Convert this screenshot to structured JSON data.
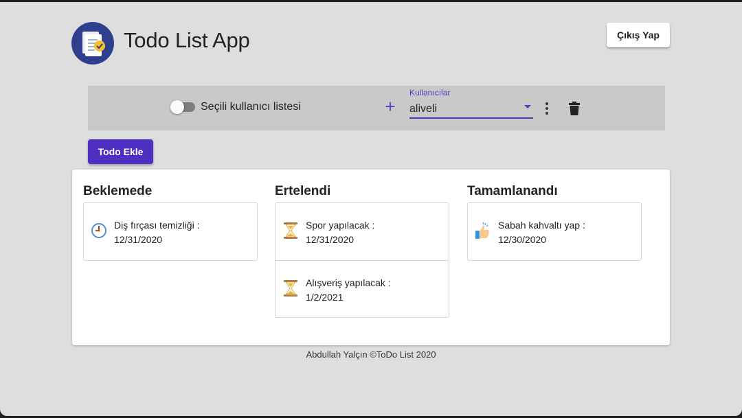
{
  "header": {
    "title": "Todo List App",
    "logout_label": "Çıkış Yap"
  },
  "toolbar": {
    "switch_label": "Seçili kullanıcı listesi",
    "add_user_glyph": "+",
    "select_label": "Kullanıcılar",
    "select_value": "aliveli"
  },
  "actions": {
    "add_todo_label": "Todo Ekle"
  },
  "columns": [
    {
      "title": "Beklemede",
      "icon": "clock-icon",
      "items": [
        {
          "title": "Diş fırçası temizliği :",
          "date": "12/31/2020"
        }
      ]
    },
    {
      "title": "Ertelendi",
      "icon": "hourglass-icon",
      "items": [
        {
          "title": "Spor yapılacak :",
          "date": "12/31/2020"
        },
        {
          "title": "Alışveriş yapılacak :",
          "date": "1/2/2021"
        }
      ]
    },
    {
      "title": "Tamamlanandı",
      "icon": "thumbs-up-icon",
      "items": [
        {
          "title": "Sabah kahvaltı yap :",
          "date": "12/30/2020"
        }
      ]
    }
  ],
  "footer": {
    "text": "Abdullah Yalçın ©ToDo List 2020"
  },
  "colors": {
    "primary": "#4f2fc2",
    "toolbar_bg": "#c9c9c9",
    "page_bg": "#dedede",
    "logo_bg": "#2f3f8f"
  }
}
